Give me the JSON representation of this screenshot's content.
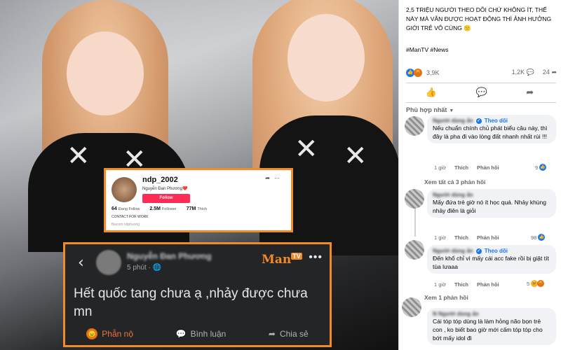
{
  "post": {
    "caption": "2,5 TRIỆU NGƯỜI THEO DÕI CHỨ KHÔNG ÍT, THẾ NÀY MÀ VẪN ĐƯỢC HOẠT ĐỘNG THÌ ẢNH HƯỞNG GIỚI TRẺ VÔ CÙNG 😕",
    "hashtags": "#ManTV #News",
    "reaction_count": "3,9K",
    "comment_count": "1,2K",
    "share_count": "24",
    "sort_label": "Phù hợp nhất"
  },
  "profile_card": {
    "username": "ndp_2002",
    "display_name": "Nguyễn Đan Phương❤️",
    "follow_label": "Follow",
    "stats": [
      {
        "value": "64",
        "label": "Đang Follow"
      },
      {
        "value": "2.5M",
        "label": "Follower"
      },
      {
        "value": "77M",
        "label": "Thích"
      }
    ],
    "contact": "CONTACT FOR WORK",
    "link": "fbacom.ndphuong"
  },
  "embedded_post": {
    "author": "Nguyễn Đan Phương",
    "time": "5 phút · 🌐",
    "logo_text": "Man",
    "logo_badge": "TV",
    "text": "Hết quốc tang chưa ạ ,nhảy được chưa mn",
    "actions": [
      {
        "label": "Phẫn nộ",
        "icon": "angry-icon"
      },
      {
        "label": "Bình luận",
        "icon": "comment-icon"
      },
      {
        "label": "Chia sẻ",
        "icon": "share-icon"
      }
    ]
  },
  "comments": [
    {
      "name": "Người dùng ẩn",
      "follow": "Theo dõi",
      "text": "Nếu chuẩn chính chủ phát biểu câu này, thì đây là pha đi vào lòng đất nhanh nhất rùi !!!",
      "time": "1 giờ",
      "like": "Thích",
      "reply": "Phản hồi",
      "react_count": "9"
    },
    {
      "view_more": "Xem tất cả 3 phản hồi"
    },
    {
      "name": "Người dùng ẩn",
      "text": "Mấy đứa trẻ giờ nó ít học quá. Nhảy khùng nhảy điên là giỏi",
      "time": "1 giờ",
      "like": "Thích",
      "reply": "Phản hồi",
      "react_count": "98"
    },
    {
      "name": "Người dùng ẩn",
      "follow": "Theo dõi",
      "text": "Đến khổ chỉ vì mấy cái acc fake rồi bị giật tít tùa lưaaa",
      "time": "1 giờ",
      "like": "Thích",
      "reply": "Phản hồi",
      "react_count": "5"
    },
    {
      "view_more": "Xem 1 phản hồi"
    },
    {
      "name": "N Người dùng ẩn",
      "text": "Cái tóp tóp dùng là làm hỏng não bọn trẻ con , ko biết bao giờ mới cấm tóp tóp cho bớt mấy idol đi"
    }
  ]
}
